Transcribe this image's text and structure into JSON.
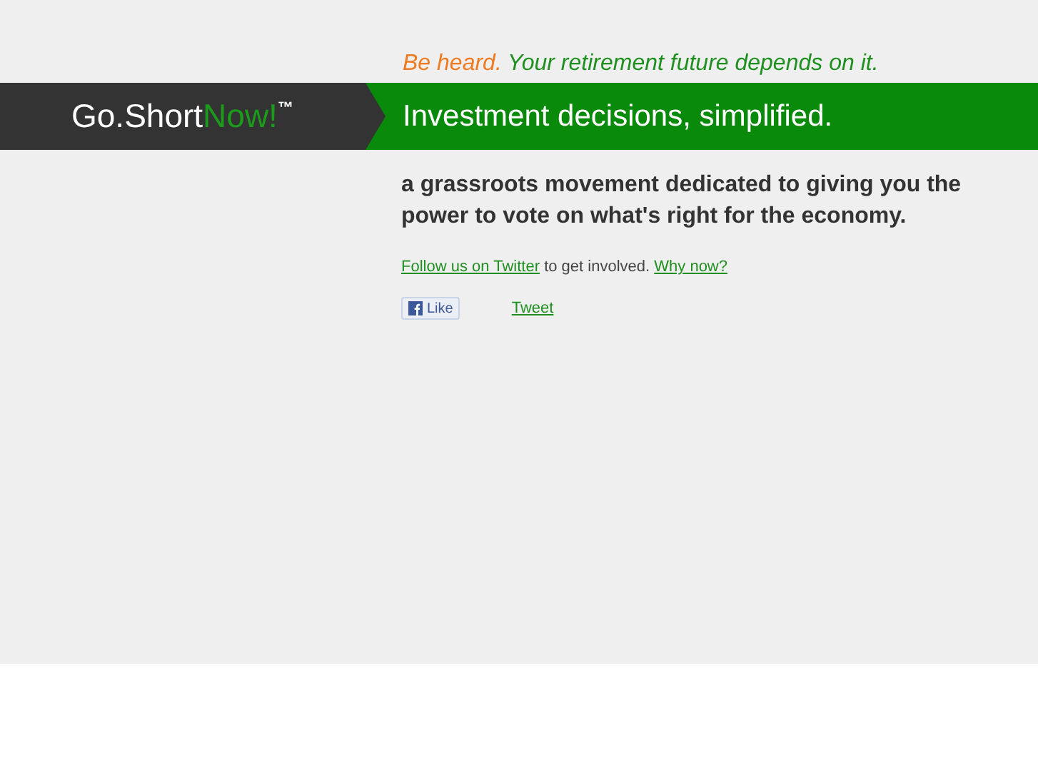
{
  "tagline": {
    "lead": "Be heard.",
    "rest": "Your retirement future depends on it."
  },
  "logo": {
    "prefix": "Go.Short",
    "accent": "Now!",
    "mark": "™"
  },
  "headline": "Investment decisions, simplified.",
  "intro": "a grassroots movement dedicated to giving you the power to vote on what's right for the economy.",
  "follow": {
    "link": "Follow us on Twitter",
    "text": "to get involved.",
    "why": "Why now?"
  },
  "social": {
    "like": "Like",
    "tweet": "Tweet"
  }
}
